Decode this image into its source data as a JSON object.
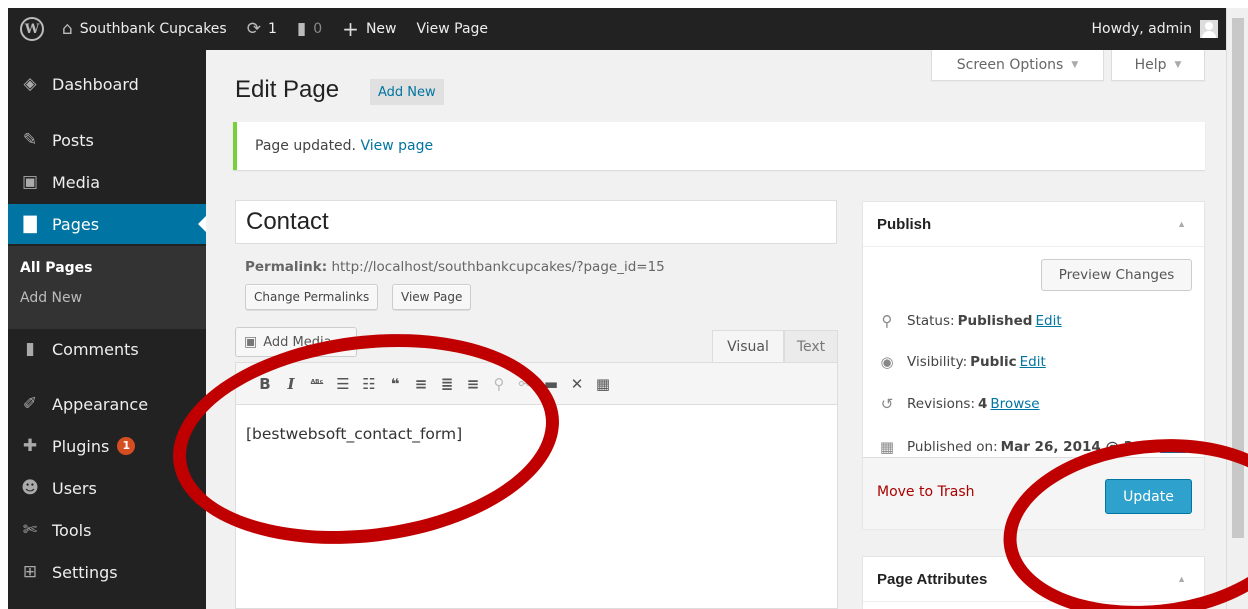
{
  "admin_bar": {
    "site_name": "Southbank Cupcakes",
    "updates_count": "1",
    "comments_count": "0",
    "new_label": "New",
    "view_page_label": "View Page",
    "howdy": "Howdy, admin",
    "icons": {
      "wp": "W",
      "home": "⌂",
      "updates": "⟳",
      "comments": "▮",
      "new": "+"
    }
  },
  "sidebar": {
    "items": [
      {
        "label": "Dashboard",
        "icon": "◈"
      },
      {
        "label": "Posts",
        "icon": "✎"
      },
      {
        "label": "Media",
        "icon": "▣"
      },
      {
        "label": "Pages",
        "icon": "▇"
      },
      {
        "label": "Comments",
        "icon": "▮"
      },
      {
        "label": "Appearance",
        "icon": "✐"
      },
      {
        "label": "Plugins",
        "icon": "✚",
        "badge": "1"
      },
      {
        "label": "Users",
        "icon": "☻"
      },
      {
        "label": "Tools",
        "icon": "✄"
      },
      {
        "label": "Settings",
        "icon": "⊞"
      }
    ],
    "submenu": [
      "All Pages",
      "Add New"
    ]
  },
  "screen_options": {
    "screen_label": "Screen Options",
    "help_label": "Help",
    "caret": "▼"
  },
  "page": {
    "heading": "Edit Page",
    "add_new_label": "Add New"
  },
  "notice": {
    "text": "Page updated.",
    "link": "View page"
  },
  "editor": {
    "title": "Contact",
    "permalink_label": "Permalink:",
    "permalink_url": "http://localhost/southbankcupcakes/?page_id=15",
    "change_permalinks": "Change Permalinks",
    "view_page": "View Page",
    "add_media": "Add Media",
    "tab_visual": "Visual",
    "tab_text": "Text",
    "content": "[bestwebsoft_contact_form]",
    "toolbar": [
      {
        "name": "bold-icon",
        "glyph": "B"
      },
      {
        "name": "italic-icon",
        "glyph": "I"
      },
      {
        "name": "strikethrough-icon",
        "glyph": "ᴬᴮᶜ"
      },
      {
        "name": "bullet-list-icon",
        "glyph": "☰"
      },
      {
        "name": "numbered-list-icon",
        "glyph": "☷"
      },
      {
        "name": "blockquote-icon",
        "glyph": "❝"
      },
      {
        "name": "align-left-icon",
        "glyph": "≡"
      },
      {
        "name": "align-center-icon",
        "glyph": "≣"
      },
      {
        "name": "align-right-icon",
        "glyph": "≡"
      },
      {
        "name": "link-icon",
        "glyph": "⚲",
        "dim": true
      },
      {
        "name": "unlink-icon",
        "glyph": "⚯",
        "dim": true
      },
      {
        "name": "read-more-icon",
        "glyph": "▬"
      },
      {
        "name": "fullscreen-icon",
        "glyph": "✕"
      },
      {
        "name": "kitchen-sink-icon",
        "glyph": "▦"
      }
    ]
  },
  "publish": {
    "title": "Publish",
    "preview_label": "Preview Changes",
    "status_label": "Status:",
    "status_value": "Published",
    "visibility_label": "Visibility:",
    "visibility_value": "Public",
    "revisions_label": "Revisions:",
    "revisions_value": "4",
    "browse_label": "Browse",
    "published_label": "Published on:",
    "published_value": "Mar 26, 2014 @ 3:33",
    "edit_label": "Edit",
    "trash_label": "Move to Trash",
    "update_label": "Update",
    "toggle": "▲"
  },
  "page_attributes": {
    "title": "Page Attributes",
    "toggle": "▲"
  },
  "colors": {
    "admin_bar_bg": "#222222",
    "active_menu": "#0074a2",
    "update_button": "#2ea2cc",
    "notice_success": "#7ad03a",
    "annotation": "#c00000"
  }
}
